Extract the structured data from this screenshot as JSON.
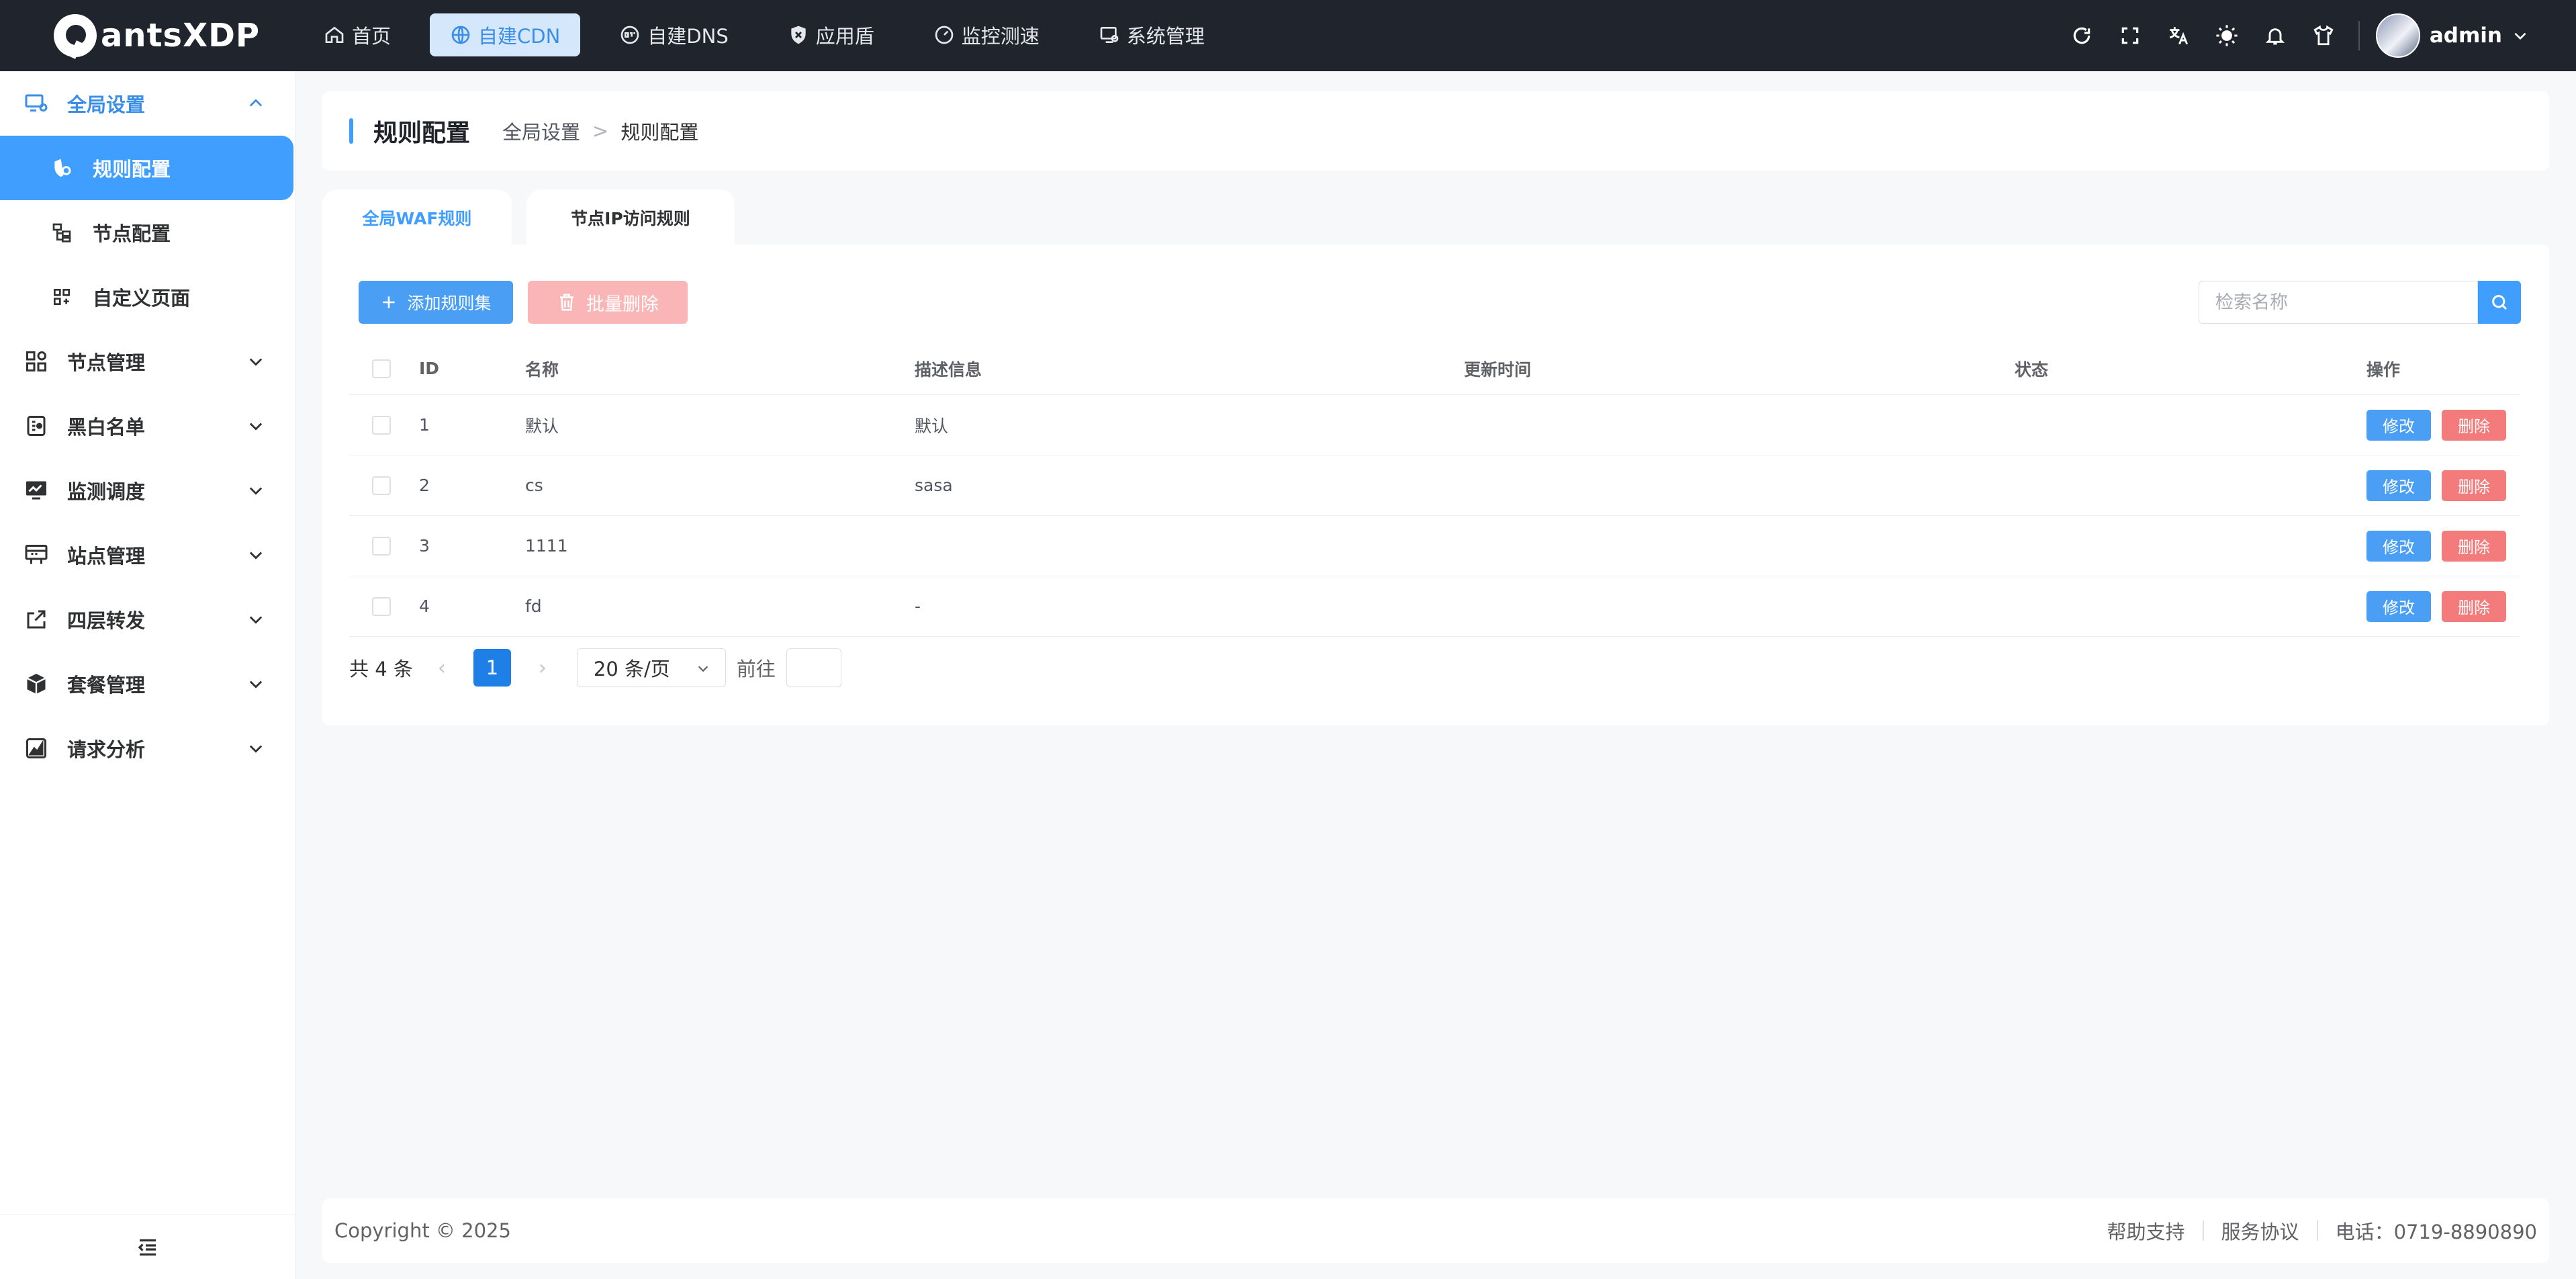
{
  "app": {
    "name": "antsXDP"
  },
  "topnav": [
    {
      "label": "首页",
      "icon": "home-icon"
    },
    {
      "label": "自建CDN",
      "icon": "globe-icon",
      "active": true
    },
    {
      "label": "自建DNS",
      "icon": "dns-icon"
    },
    {
      "label": "应用盾",
      "icon": "shield-icon"
    },
    {
      "label": "监控测速",
      "icon": "gauge-icon"
    },
    {
      "label": "系统管理",
      "icon": "monitor-gear-icon"
    }
  ],
  "user": {
    "name": "admin"
  },
  "sidebar": {
    "groups": [
      {
        "label": "全局设置",
        "open": true,
        "items": [
          {
            "label": "规则配置",
            "active": true
          },
          {
            "label": "节点配置"
          },
          {
            "label": "自定义页面"
          }
        ]
      },
      {
        "label": "节点管理"
      },
      {
        "label": "黑白名单"
      },
      {
        "label": "监测调度"
      },
      {
        "label": "站点管理"
      },
      {
        "label": "四层转发"
      },
      {
        "label": "套餐管理"
      },
      {
        "label": "请求分析"
      }
    ]
  },
  "header": {
    "title": "规则配置",
    "breadcrumb": [
      "全局设置",
      "规则配置"
    ],
    "breadcrumb_sep": ">"
  },
  "tabs": [
    {
      "label": "全局WAF规则",
      "active": true
    },
    {
      "label": "节点IP访问规则"
    }
  ],
  "toolbar": {
    "add_label": "添加规则集",
    "batch_delete_label": "批量删除",
    "search_placeholder": "检索名称"
  },
  "table": {
    "columns": [
      "ID",
      "名称",
      "描述信息",
      "更新时间",
      "状态",
      "操作"
    ],
    "rows": [
      {
        "id": "1",
        "name": "默认",
        "desc": "默认",
        "time": "",
        "status": ""
      },
      {
        "id": "2",
        "name": "cs",
        "desc": "sasa",
        "time": "",
        "status": ""
      },
      {
        "id": "3",
        "name": "1111",
        "desc": "",
        "time": "",
        "status": ""
      },
      {
        "id": "4",
        "name": "fd",
        "desc": "-",
        "time": "",
        "status": ""
      }
    ],
    "edit_label": "修改",
    "delete_label": "删除"
  },
  "pagination": {
    "total_text": "共 4 条",
    "current_page": "1",
    "page_size": "20 条/页",
    "goto_label": "前往",
    "goto_value": ""
  },
  "footer": {
    "copyright": "Copyright © 2025",
    "help": "帮助支持",
    "terms": "服务协议",
    "phone": "电话：0719-8890890"
  },
  "colors": {
    "primary": "#409eff",
    "danger": "#f47b7b",
    "topbar": "#20242c"
  }
}
